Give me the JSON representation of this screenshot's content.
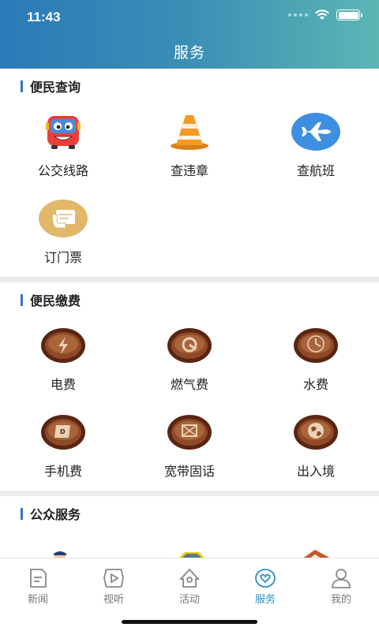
{
  "status": {
    "time": "11:43"
  },
  "header": {
    "title": "服务"
  },
  "sections": [
    {
      "title": "便民查询",
      "items": [
        {
          "label": "公交线路",
          "icon": "bus-icon"
        },
        {
          "label": "查违章",
          "icon": "traffic-cone-icon"
        },
        {
          "label": "查航班",
          "icon": "airplane-icon"
        },
        {
          "label": "订门票",
          "icon": "ticket-icon"
        }
      ]
    },
    {
      "title": "便民缴费",
      "items": [
        {
          "label": "电费",
          "icon": "electricity-icon"
        },
        {
          "label": "燃气费",
          "icon": "gas-icon"
        },
        {
          "label": "水费",
          "icon": "water-clock-icon"
        },
        {
          "label": "手机费",
          "icon": "phone-bill-icon"
        },
        {
          "label": "宽带固话",
          "icon": "broadband-icon"
        },
        {
          "label": "出入境",
          "icon": "globe-icon"
        }
      ]
    },
    {
      "title": "公众服务",
      "items": [
        {
          "label": "",
          "icon": "service-person-icon"
        },
        {
          "label": "",
          "icon": "taxi-icon"
        },
        {
          "label": "",
          "icon": "house-icon"
        }
      ]
    }
  ],
  "tabbar": {
    "items": [
      {
        "label": "新闻",
        "icon": "news-icon"
      },
      {
        "label": "视听",
        "icon": "play-icon"
      },
      {
        "label": "活动",
        "icon": "activity-icon"
      },
      {
        "label": "服务",
        "icon": "service-heart-icon",
        "active": true
      },
      {
        "label": "我的",
        "icon": "profile-icon"
      }
    ]
  },
  "colors": {
    "accent": "#2a8fc0",
    "section_bar": "#2f77c2",
    "header_start": "#2a7ab8",
    "header_end": "#5cb6b4"
  }
}
